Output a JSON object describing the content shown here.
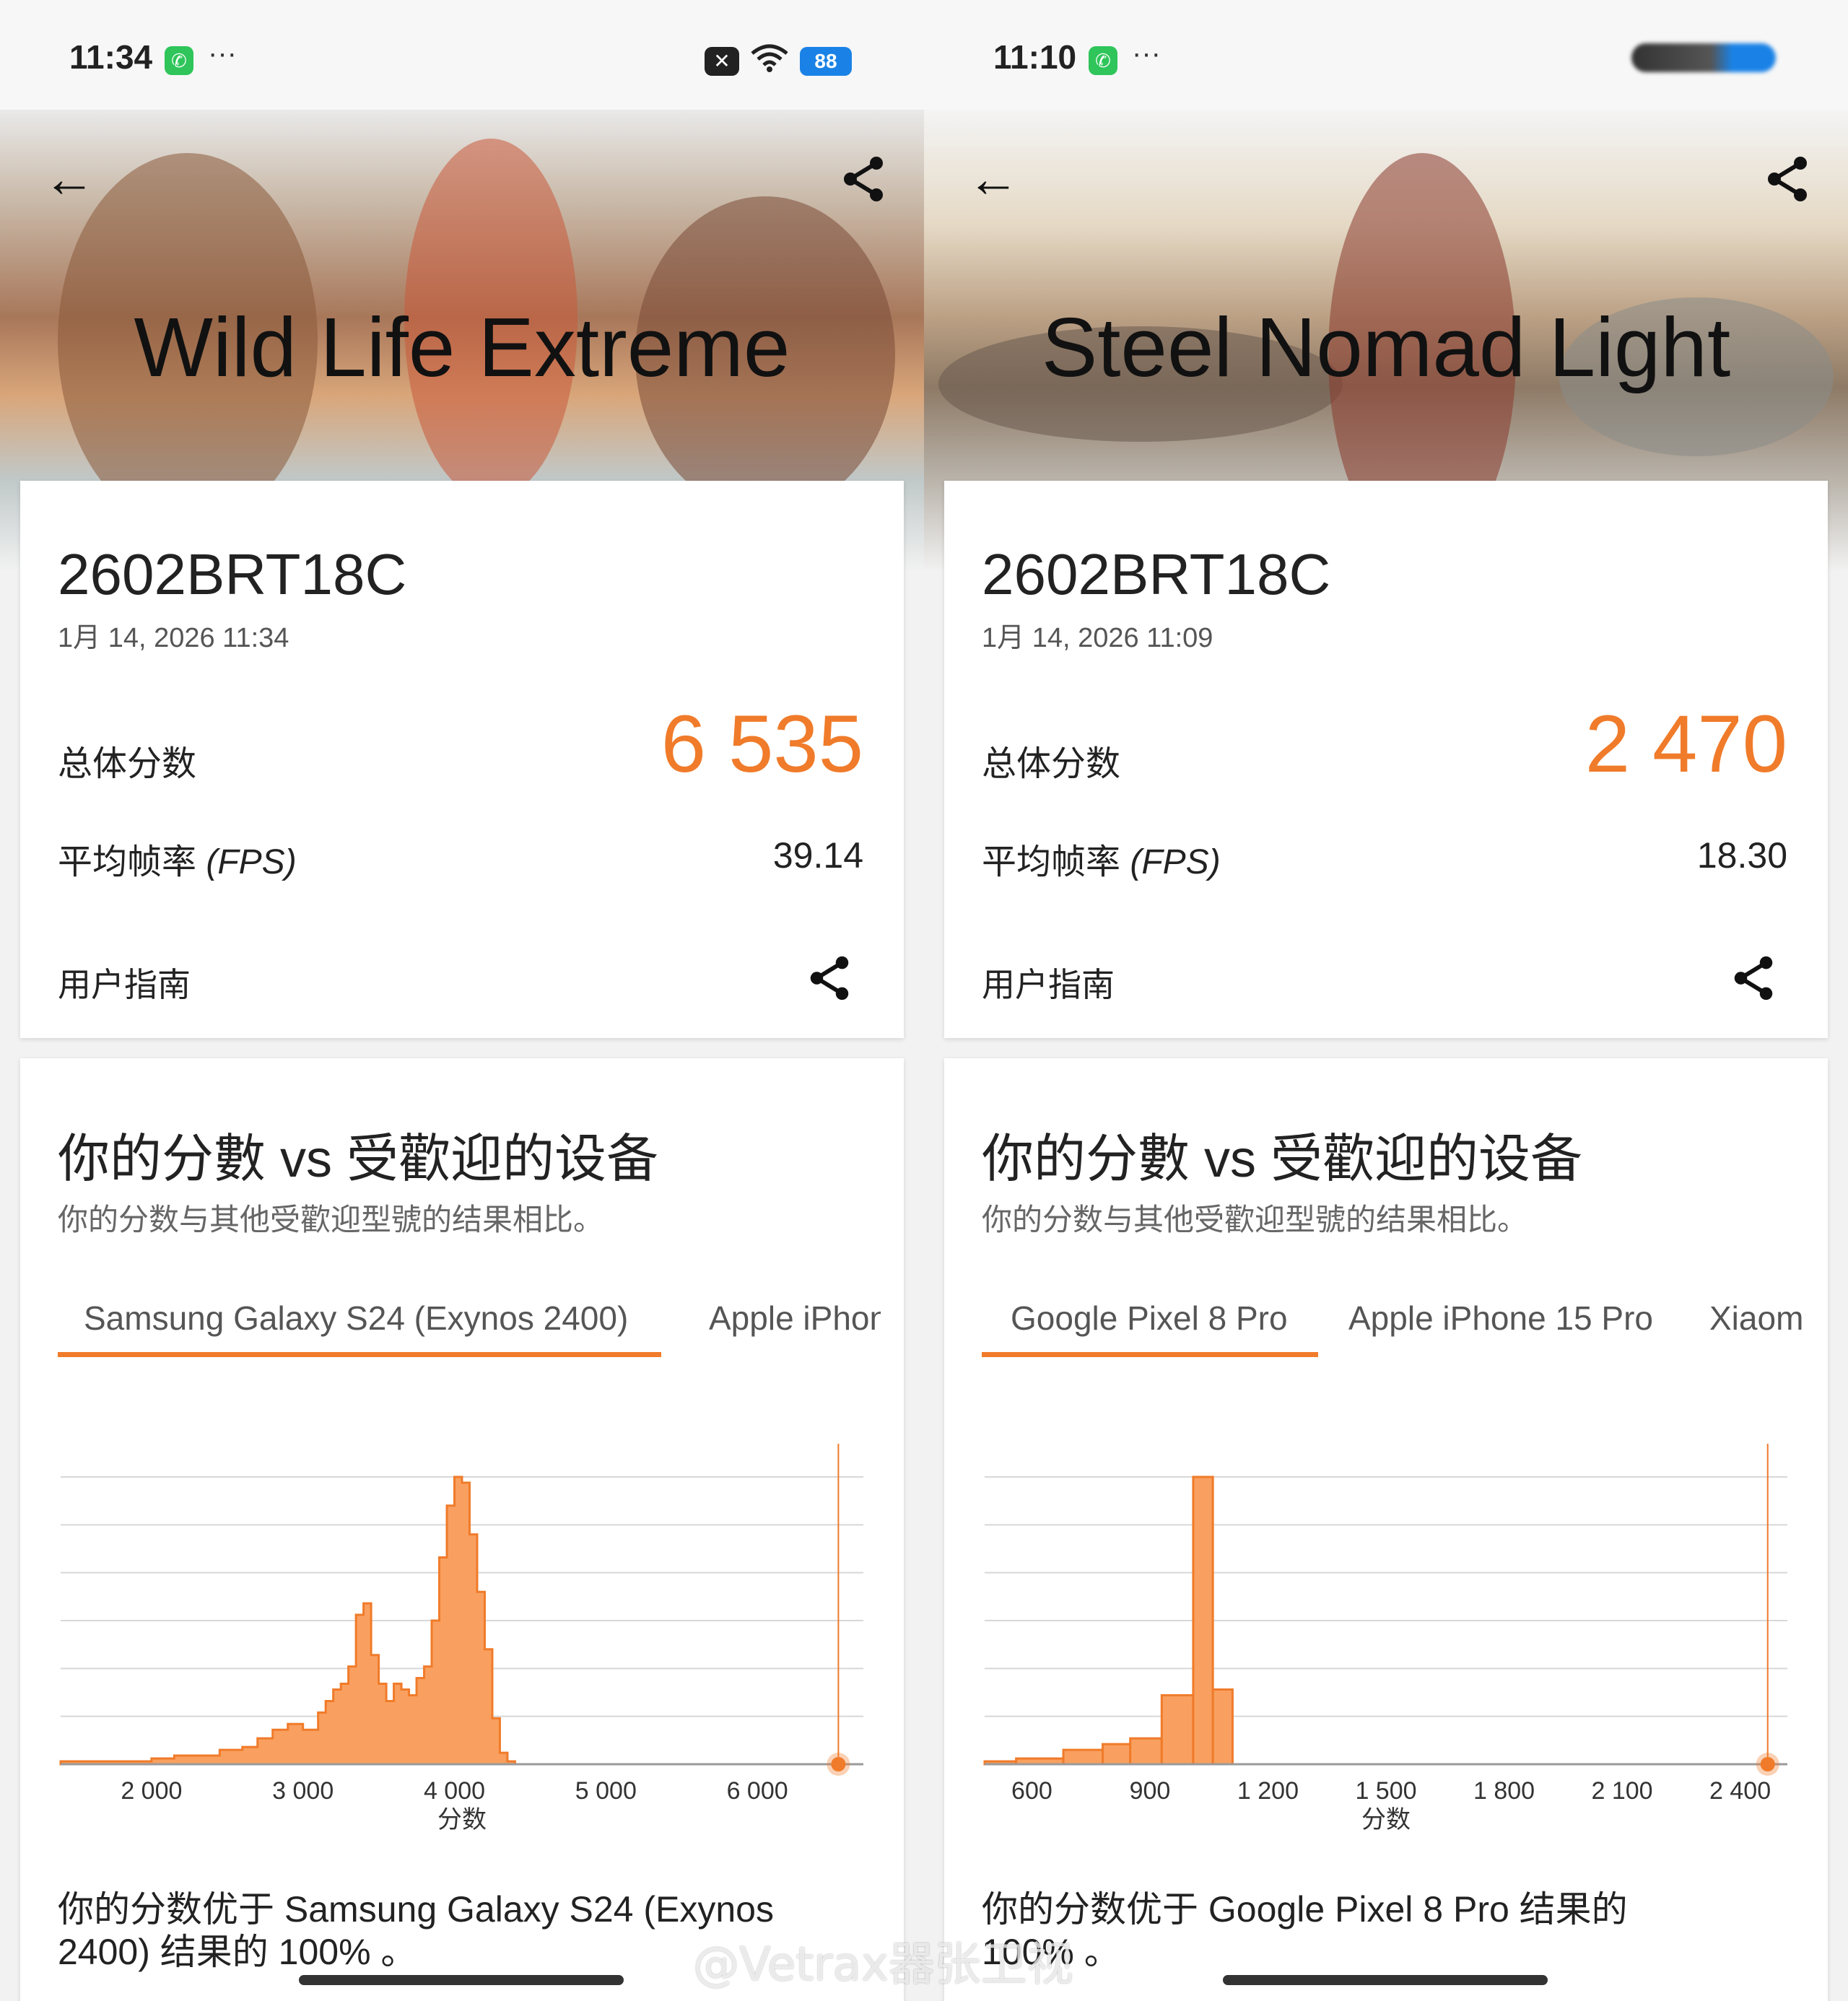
{
  "left": {
    "status": {
      "time": "11:34",
      "dots": "···",
      "battery": "88",
      "close_glyph": "✕",
      "wifi_glyph": "≋"
    },
    "hero_title": "Wild Life Extreme",
    "device": "2602BRT18C",
    "date": "1月 14, 2026 11:34",
    "total_label": "总体分数",
    "score": "6 535",
    "fps_label": "平均帧率",
    "fps_unit": "(FPS)",
    "fps": "39.14",
    "guide": "用户指南",
    "compare_title": "你的分數 vs 受歡迎的设备",
    "compare_sub": "你的分数与其他受歡迎型號的结果相比。",
    "tabs": [
      "Samsung Galaxy S24 (Exynos 2400)",
      "Apple iPhon"
    ],
    "result_line1": "你的分数优于 Samsung Galaxy S24 (Exynos",
    "result_line2": "2400) 结果的 100% 。",
    "chart_data": {
      "type": "area",
      "xlabel": "分数",
      "ylabel": "",
      "x_ticks": [
        "2 000",
        "3 000",
        "4 000",
        "5 000",
        "6 000"
      ],
      "xlim": [
        1400,
        6700
      ],
      "ylim": [
        0,
        100
      ],
      "your_score": 6535,
      "x": [
        1400,
        1550,
        1700,
        1850,
        2000,
        2150,
        2300,
        2450,
        2600,
        2700,
        2800,
        2900,
        3000,
        3100,
        3150,
        3200,
        3250,
        3300,
        3350,
        3400,
        3450,
        3500,
        3550,
        3600,
        3650,
        3700,
        3750,
        3800,
        3850,
        3900,
        3950,
        4000,
        4050,
        4100,
        4150,
        4200,
        4250,
        4300,
        4350,
        4400,
        4450,
        4500
      ],
      "values": [
        1,
        1,
        1,
        1,
        2,
        3,
        3,
        5,
        6,
        9,
        12,
        14,
        12,
        18,
        22,
        26,
        28,
        34,
        52,
        56,
        38,
        28,
        22,
        28,
        26,
        24,
        30,
        34,
        50,
        72,
        90,
        100,
        98,
        80,
        60,
        40,
        16,
        4,
        1,
        0,
        0,
        0
      ]
    }
  },
  "right": {
    "status": {
      "time": "11:10",
      "dots": "···"
    },
    "hero_title": "Steel Nomad Light",
    "device": "2602BRT18C",
    "date": "1月 14, 2026 11:09",
    "total_label": "总体分数",
    "score": "2 470",
    "fps_label": "平均帧率",
    "fps_unit": "(FPS)",
    "fps": "18.30",
    "guide": "用户指南",
    "compare_title": "你的分數 vs 受歡迎的设备",
    "compare_sub": "你的分数与其他受歡迎型號的结果相比。",
    "tabs": [
      "Google Pixel 8 Pro",
      "Apple iPhone 15 Pro",
      "Xiaom"
    ],
    "result_line1": "你的分数优于 Google Pixel 8 Pro 结果的",
    "result_line2": "100% 。",
    "chart_data": {
      "type": "bar",
      "xlabel": "分数",
      "ylabel": "",
      "x_ticks": [
        "600",
        "900",
        "1 200",
        "1 500",
        "1 800",
        "2 100",
        "2 400"
      ],
      "xlim": [
        480,
        2520
      ],
      "ylim": [
        0,
        100
      ],
      "your_score": 2470,
      "bins": [
        [
          480,
          560
        ],
        [
          560,
          680
        ],
        [
          680,
          780
        ],
        [
          780,
          850
        ],
        [
          850,
          930
        ],
        [
          930,
          1010
        ],
        [
          1010,
          1060
        ],
        [
          1060,
          1110
        ]
      ],
      "values": [
        0,
        1,
        2,
        5,
        7,
        9,
        24,
        100,
        26
      ]
    }
  },
  "watermark": "@Vetrax器张卫视",
  "colors": {
    "accent": "#f07b2a",
    "fill": "#f9a060",
    "grid": "#d8d8d8"
  }
}
